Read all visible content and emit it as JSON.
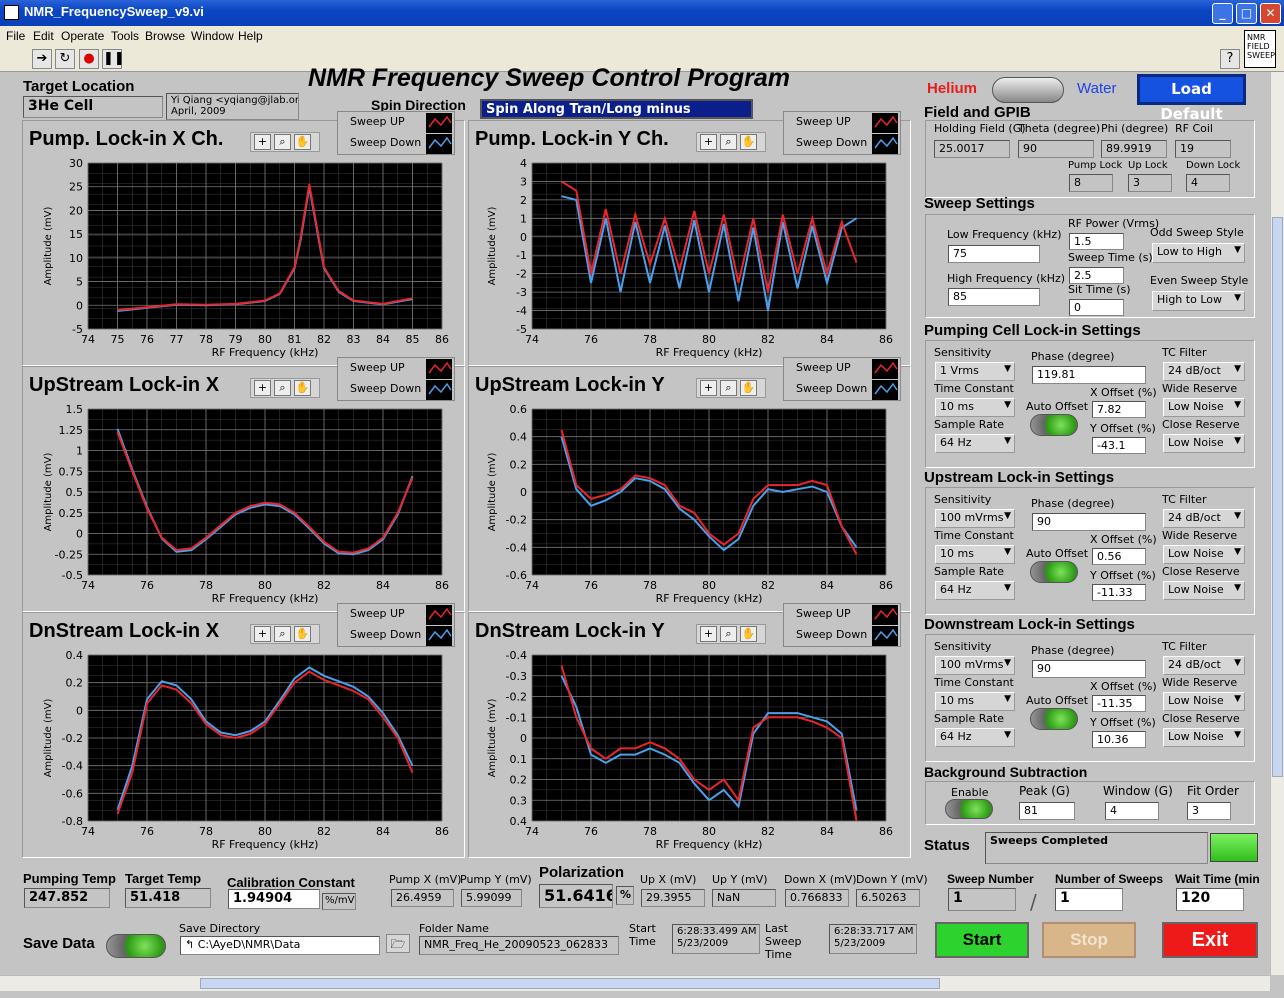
{
  "window": {
    "title": "NMR_FrequencySweep_v9.vi"
  },
  "menu": [
    "File",
    "Edit",
    "Operate",
    "Tools",
    "Browse",
    "Window",
    "Help"
  ],
  "toolbar": {
    "logo_lines": [
      "NMR",
      "FIELD",
      "SWEEP"
    ]
  },
  "header": {
    "program_title": "NMR Frequency Sweep Control Program",
    "target_location_label": "Target Location",
    "target_location_value": "3He Cell",
    "author_line1": "Yi Qiang <yqiang@jlab.org>",
    "author_line2": "April, 2009",
    "spin_direction_label": "Spin Direction",
    "spin_direction_value": "Spin Along Tran/Long minus",
    "helium_label": "Helium",
    "water_label": "Water",
    "load_default": "Load Default"
  },
  "legend": {
    "up": "Sweep UP",
    "down": "Sweep Down"
  },
  "colors": {
    "up": "#e8262b",
    "down": "#4aa0ea"
  },
  "axis_xlabel": "RF Frequency (kHz)",
  "axis_ylabel": "Amplitude (mV)",
  "charts": [
    {
      "title": "Pump. Lock-in X Ch.",
      "xticks": [
        "74",
        "75",
        "76",
        "77",
        "78",
        "79",
        "80",
        "81",
        "82",
        "83",
        "84",
        "85",
        "86"
      ],
      "yticks": [
        "30",
        "25",
        "20",
        "15",
        "10",
        "5",
        "0",
        "-5"
      ]
    },
    {
      "title": "Pump. Lock-in Y Ch.",
      "xticks": [
        "74",
        "76",
        "78",
        "80",
        "82",
        "84",
        "86"
      ],
      "yticks": [
        "4",
        "3",
        "2",
        "1",
        "0",
        "-1",
        "-2",
        "-3",
        "-4",
        "-5"
      ]
    },
    {
      "title": "UpStream Lock-in X",
      "xticks": [
        "74",
        "76",
        "78",
        "80",
        "82",
        "84",
        "86"
      ],
      "yticks": [
        "1.5",
        "1.25",
        "1",
        "0.75",
        "0.5",
        "0.25",
        "0",
        "-0.25",
        "-0.5"
      ]
    },
    {
      "title": "UpStream Lock-in Y",
      "xticks": [
        "74",
        "76",
        "78",
        "80",
        "82",
        "84",
        "86"
      ],
      "yticks": [
        "0.6",
        "0.4",
        "0.2",
        "0",
        "-0.2",
        "-0.4",
        "-0.6"
      ]
    },
    {
      "title": "DnStream Lock-in X",
      "xticks": [
        "74",
        "76",
        "78",
        "80",
        "82",
        "84",
        "86"
      ],
      "yticks": [
        "0.4",
        "0.2",
        "0",
        "-0.2",
        "-0.4",
        "-0.6",
        "-0.8"
      ]
    },
    {
      "title": "DnStream Lock-in Y",
      "xticks": [
        "74",
        "76",
        "78",
        "80",
        "82",
        "84",
        "86"
      ],
      "yticks": [
        "-0.4",
        "-0.3",
        "-0.2",
        "-0.1",
        "0",
        "0.1",
        "0.2",
        "0.3",
        "0.4"
      ]
    }
  ],
  "chart_data": [
    {
      "type": "line",
      "title": "Pump. Lock-in X Ch.",
      "xlabel": "RF Frequency (kHz)",
      "ylabel": "Amplitude (mV)",
      "xlim": [
        74,
        86
      ],
      "ylim": [
        -5,
        30
      ],
      "series": [
        {
          "name": "Sweep UP",
          "x": [
            75,
            76,
            77,
            78,
            79,
            80,
            80.5,
            81,
            81.2,
            81.5,
            81.8,
            82,
            82.5,
            83,
            84,
            85
          ],
          "y": [
            -1,
            -0.4,
            0.2,
            0.1,
            0.3,
            1,
            2.5,
            8,
            14,
            25.5,
            15,
            8,
            3,
            1,
            0.3,
            1.5
          ]
        },
        {
          "name": "Sweep Down",
          "x": [
            75,
            76,
            77,
            78,
            79,
            80,
            80.5,
            81,
            81.2,
            81.5,
            81.8,
            82,
            82.5,
            83,
            84,
            85
          ],
          "y": [
            -1.2,
            -0.5,
            0.1,
            0,
            0.2,
            0.9,
            2.4,
            7.8,
            13.5,
            25,
            14.5,
            7.8,
            2.8,
            0.9,
            0.2,
            1.3
          ]
        }
      ]
    },
    {
      "type": "line",
      "title": "Pump. Lock-in Y Ch.",
      "xlabel": "RF Frequency (kHz)",
      "ylabel": "Amplitude (mV)",
      "xlim": [
        74,
        86
      ],
      "ylim": [
        -5,
        4
      ],
      "series": [
        {
          "name": "Sweep UP",
          "x": [
            75,
            75.5,
            76,
            76.5,
            77,
            77.5,
            78,
            78.5,
            79,
            79.5,
            80,
            80.5,
            81,
            81.5,
            82,
            82.5,
            83,
            83.5,
            84,
            84.5,
            85
          ],
          "y": [
            3,
            2.5,
            -2,
            1.5,
            -2,
            1.2,
            -1.5,
            1,
            -1.8,
            1.4,
            -2,
            1.2,
            -2.5,
            1,
            -3,
            1.2,
            -2,
            1,
            -2,
            0.8,
            -1.4
          ]
        },
        {
          "name": "Sweep Down",
          "x": [
            75,
            75.5,
            76,
            76.5,
            77,
            77.5,
            78,
            78.5,
            79,
            79.5,
            80,
            80.5,
            81,
            81.5,
            82,
            82.5,
            83,
            83.5,
            84,
            84.5,
            85
          ],
          "y": [
            2.2,
            2,
            -2.5,
            1,
            -3,
            0.8,
            -2.5,
            0.6,
            -2.8,
            0.9,
            -3,
            0.7,
            -3.5,
            0.5,
            -4,
            0.8,
            -2.8,
            0.6,
            -2.5,
            0.5,
            1
          ]
        }
      ]
    },
    {
      "type": "line",
      "title": "UpStream Lock-in X",
      "xlabel": "RF Frequency (kHz)",
      "ylabel": "Amplitude (mV)",
      "xlim": [
        74,
        86
      ],
      "ylim": [
        -0.5,
        1.5
      ],
      "series": [
        {
          "name": "Sweep UP",
          "x": [
            75,
            75.5,
            76,
            76.5,
            77,
            77.5,
            78,
            78.5,
            79,
            79.5,
            80,
            80.5,
            81,
            81.5,
            82,
            82.5,
            83,
            83.5,
            84,
            84.5,
            85
          ],
          "y": [
            1.22,
            0.75,
            0.3,
            -0.05,
            -0.2,
            -0.18,
            -0.05,
            0.1,
            0.25,
            0.33,
            0.37,
            0.35,
            0.25,
            0.08,
            -0.1,
            -0.22,
            -0.23,
            -0.18,
            -0.05,
            0.25,
            0.67
          ]
        },
        {
          "name": "Sweep Down",
          "x": [
            75,
            75.5,
            76,
            76.5,
            77,
            77.5,
            78,
            78.5,
            79,
            79.5,
            80,
            80.5,
            81,
            81.5,
            82,
            82.5,
            83,
            83.5,
            84,
            84.5,
            85
          ],
          "y": [
            1.26,
            0.77,
            0.32,
            -0.06,
            -0.22,
            -0.2,
            -0.07,
            0.08,
            0.23,
            0.31,
            0.35,
            0.33,
            0.23,
            0.06,
            -0.12,
            -0.24,
            -0.25,
            -0.2,
            -0.07,
            0.23,
            0.69
          ]
        }
      ]
    },
    {
      "type": "line",
      "title": "UpStream Lock-in Y",
      "xlabel": "RF Frequency (kHz)",
      "ylabel": "Amplitude (mV)",
      "xlim": [
        74,
        86
      ],
      "ylim": [
        -0.6,
        0.6
      ],
      "series": [
        {
          "name": "Sweep UP",
          "x": [
            75,
            75.5,
            76,
            76.5,
            77,
            77.5,
            78,
            78.5,
            79,
            79.5,
            80,
            80.5,
            81,
            81.5,
            82,
            82.5,
            83,
            83.5,
            84,
            84.5,
            85
          ],
          "y": [
            0.45,
            0.05,
            -0.05,
            -0.02,
            0.02,
            0.12,
            0.1,
            0.05,
            -0.1,
            -0.15,
            -0.3,
            -0.38,
            -0.3,
            -0.05,
            0.05,
            0.05,
            0.05,
            0.08,
            0.05,
            -0.25,
            -0.45
          ]
        },
        {
          "name": "Sweep Down",
          "x": [
            75,
            75.5,
            76,
            76.5,
            77,
            77.5,
            78,
            78.5,
            79,
            79.5,
            80,
            80.5,
            81,
            81.5,
            82,
            82.5,
            83,
            83.5,
            84,
            84.5,
            85
          ],
          "y": [
            0.4,
            0.02,
            -0.1,
            -0.06,
            0,
            0.1,
            0.08,
            0.02,
            -0.12,
            -0.2,
            -0.32,
            -0.42,
            -0.34,
            -0.1,
            0.02,
            0,
            0.02,
            0.04,
            0,
            -0.25,
            -0.4
          ]
        }
      ]
    },
    {
      "type": "line",
      "title": "DnStream Lock-in X",
      "xlabel": "RF Frequency (kHz)",
      "ylabel": "Amplitude (mV)",
      "xlim": [
        74,
        86
      ],
      "ylim": [
        -0.8,
        0.4
      ],
      "series": [
        {
          "name": "Sweep UP",
          "x": [
            75,
            75.5,
            76,
            76.5,
            77,
            77.5,
            78,
            78.5,
            79,
            79.5,
            80,
            80.5,
            81,
            81.5,
            82,
            82.5,
            83,
            83.5,
            84,
            84.5,
            85
          ],
          "y": [
            -0.75,
            -0.45,
            0.05,
            0.18,
            0.15,
            0.05,
            -0.1,
            -0.18,
            -0.2,
            -0.17,
            -0.1,
            0.05,
            0.2,
            0.28,
            0.22,
            0.18,
            0.14,
            0.08,
            -0.05,
            -0.2,
            -0.45
          ]
        },
        {
          "name": "Sweep Down",
          "x": [
            75,
            75.5,
            76,
            76.5,
            77,
            77.5,
            78,
            78.5,
            79,
            79.5,
            80,
            80.5,
            81,
            81.5,
            82,
            82.5,
            83,
            83.5,
            84,
            84.5,
            85
          ],
          "y": [
            -0.72,
            -0.4,
            0.08,
            0.21,
            0.18,
            0.08,
            -0.08,
            -0.16,
            -0.18,
            -0.15,
            -0.08,
            0.07,
            0.23,
            0.31,
            0.25,
            0.21,
            0.17,
            0.1,
            -0.02,
            -0.18,
            -0.4
          ]
        }
      ]
    },
    {
      "type": "line",
      "title": "DnStream Lock-in Y",
      "xlabel": "RF Frequency (kHz)",
      "ylabel": "Amplitude (mV)",
      "xlim": [
        74,
        86
      ],
      "ylim": [
        -0.4,
        0.4
      ],
      "series": [
        {
          "name": "Sweep UP",
          "x": [
            75,
            75.5,
            76,
            76.5,
            77,
            77.5,
            78,
            78.5,
            79,
            79.5,
            80,
            80.5,
            81,
            81.5,
            82,
            82.5,
            83,
            83.5,
            84,
            84.5,
            85
          ],
          "y": [
            -0.35,
            -0.1,
            0.05,
            0.1,
            0.05,
            0.05,
            0.02,
            0.05,
            0.1,
            0.2,
            0.25,
            0.2,
            0.3,
            -0.05,
            -0.1,
            -0.1,
            -0.1,
            -0.08,
            -0.05,
            0,
            0.4
          ]
        },
        {
          "name": "Sweep Down",
          "x": [
            75,
            75.5,
            76,
            76.5,
            77,
            77.5,
            78,
            78.5,
            79,
            79.5,
            80,
            80.5,
            81,
            81.5,
            82,
            82.5,
            83,
            83.5,
            84,
            84.5,
            85
          ],
          "y": [
            -0.3,
            -0.15,
            0.08,
            0.12,
            0.08,
            0.08,
            0.05,
            0.08,
            0.12,
            0.22,
            0.3,
            0.25,
            0.33,
            -0.02,
            -0.12,
            -0.12,
            -0.12,
            -0.1,
            -0.08,
            -0.02,
            0.35
          ]
        }
      ]
    }
  ],
  "field": {
    "section": "Field and GPIB",
    "holding_label": "Holding Field (G)",
    "holding": "25.0017",
    "theta_label": "Theta (degree)",
    "theta": "90",
    "phi_label": "Phi (degree)",
    "phi": "89.9919",
    "rf_label": "RF Coil",
    "rf": "19",
    "pump_lock_label": "Pump Lock",
    "pump_lock": "8",
    "up_lock_label": "Up Lock",
    "up_lock": "3",
    "down_lock_label": "Down Lock",
    "down_lock": "4"
  },
  "sweep": {
    "section": "Sweep Settings",
    "low_label": "Low Frequency (kHz)",
    "low": "75",
    "high_label": "High Frequency (kHz)",
    "high": "85",
    "rfpower_label": "RF Power (Vrms)",
    "rfpower": "1.5",
    "time_label": "Sweep Time (s)",
    "time": "2.5",
    "sit_label": "Sit Time (s)",
    "sit": "0",
    "odd_label": "Odd Sweep Style",
    "odd": "Low to High",
    "even_label": "Even Sweep Style",
    "even": "High to Low"
  },
  "lockins": [
    {
      "section": "Pumping Cell Lock-in Settings",
      "sensitivity": "1 Vrms",
      "phase": "119.81",
      "tc_filter": "24 dB/oct",
      "time_constant": "10 ms",
      "x_offset": "7.82",
      "wide": "Low Noise",
      "sample_rate": "64 Hz",
      "y_offset": "-43.1",
      "close": "Low Noise"
    },
    {
      "section": "Upstream Lock-in Settings",
      "sensitivity": "100 mVrms",
      "phase": "90",
      "tc_filter": "24 dB/oct",
      "time_constant": "10 ms",
      "x_offset": "0.56",
      "wide": "Low Noise",
      "sample_rate": "64 Hz",
      "y_offset": "-11.33",
      "close": "Low Noise"
    },
    {
      "section": "Downstream Lock-in Settings",
      "sensitivity": "100 mVrms",
      "phase": "90",
      "tc_filter": "24 dB/oct",
      "time_constant": "10 ms",
      "x_offset": "-11.35",
      "wide": "Low Noise",
      "sample_rate": "64 Hz",
      "y_offset": "10.36",
      "close": "Low Noise"
    }
  ],
  "lockin_labels": {
    "sensitivity": "Sensitivity",
    "phase": "Phase (degree)",
    "tc_filter": "TC Filter",
    "time_constant": "Time Constant",
    "auto_offset": "Auto Offset",
    "x_offset": "X Offset (%)",
    "wide": "Wide Reserve",
    "sample_rate": "Sample Rate",
    "y_offset": "Y Offset (%)",
    "close": "Close Reserve"
  },
  "background": {
    "section": "Background Subtraction",
    "enable_label": "Enable",
    "peak_label": "Peak (G)",
    "peak": "81",
    "window_label": "Window (G)",
    "window": "4",
    "fit_label": "Fit Order",
    "fit": "3"
  },
  "status": {
    "label": "Status",
    "value": "Sweeps Completed"
  },
  "bottom": {
    "pumping_temp_label": "Pumping Temp",
    "pumping_temp": "247.852",
    "target_temp_label": "Target Temp",
    "target_temp": "51.418",
    "cal_label": "Calibration Constant",
    "cal": "1.94904",
    "cal_unit": "%/mV",
    "pumpx_label": "Pump X (mV)",
    "pumpx": "26.4959",
    "pumpy_label": "Pump Y (mV)",
    "pumpy": "5.99099",
    "pol_label": "Polarization",
    "pol": "51.6416",
    "pol_unit": "%",
    "upx_label": "Up X (mV)",
    "upx": "29.3955",
    "upy_label": "Up Y (mV)",
    "upy": "NaN",
    "downx_label": "Down X (mV)",
    "downx": "0.766833",
    "downy_label": "Down Y (mV)",
    "downy": "6.50263",
    "sweepnum_label": "Sweep Number",
    "sweepnum": "1",
    "numsweeps_label": "Number of Sweeps",
    "numsweeps": "1",
    "wait_label": "Wait Time (min",
    "wait": "120",
    "save_label": "Save Data",
    "savedir_label": "Save Directory",
    "savedir": "C:\\AyeD\\NMR\\Data",
    "folder_label": "Folder Name",
    "folder": "NMR_Freq_He_20090523_062833",
    "start_label": "Start Time",
    "start_time": "6:28:33.499 AM",
    "start_date": "5/23/2009",
    "last_label": "Last Sweep Time",
    "last_time": "6:28:33.717 AM",
    "last_date": "5/23/2009",
    "start_btn": "Start",
    "stop_btn": "Stop",
    "exit_btn": "Exit"
  }
}
